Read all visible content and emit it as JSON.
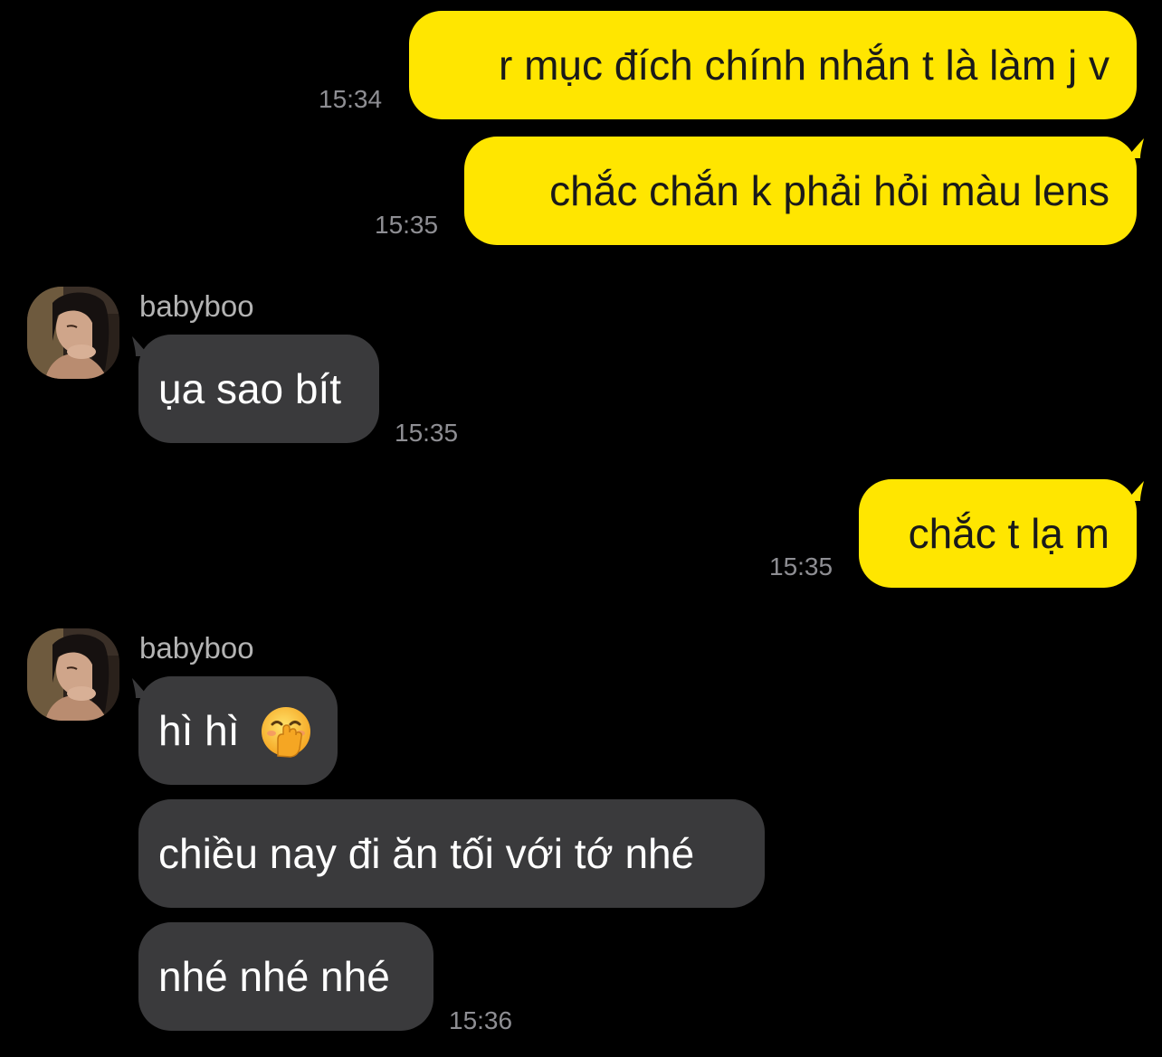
{
  "colors": {
    "background": "#000000",
    "outgoing_bubble": "#FFE600",
    "incoming_bubble": "#3a3a3c",
    "timestamp": "#8e8e93",
    "sender_name": "#b3b3b3"
  },
  "messages": [
    {
      "direction": "outgoing",
      "text": "r mục đích chính nhắn t là làm j v",
      "time": "15:34"
    },
    {
      "direction": "outgoing",
      "text": "chắc chắn k phải hỏi màu lens",
      "time": "15:35"
    },
    {
      "direction": "incoming",
      "sender": "babyboo",
      "avatar_icon": "profile-photo-avatar",
      "text": "ụa sao bít",
      "time": "15:35"
    },
    {
      "direction": "outgoing",
      "text": "chắc t lạ m",
      "time": "15:35"
    },
    {
      "direction": "incoming",
      "sender": "babyboo",
      "avatar_icon": "profile-photo-avatar",
      "text": "hì hì",
      "emoji": "face-with-hand-over-mouth-icon"
    },
    {
      "direction": "incoming",
      "text": "chiều nay đi ăn tối với tớ nhé"
    },
    {
      "direction": "incoming",
      "text": "nhé nhé nhé",
      "time": "15:36"
    }
  ]
}
